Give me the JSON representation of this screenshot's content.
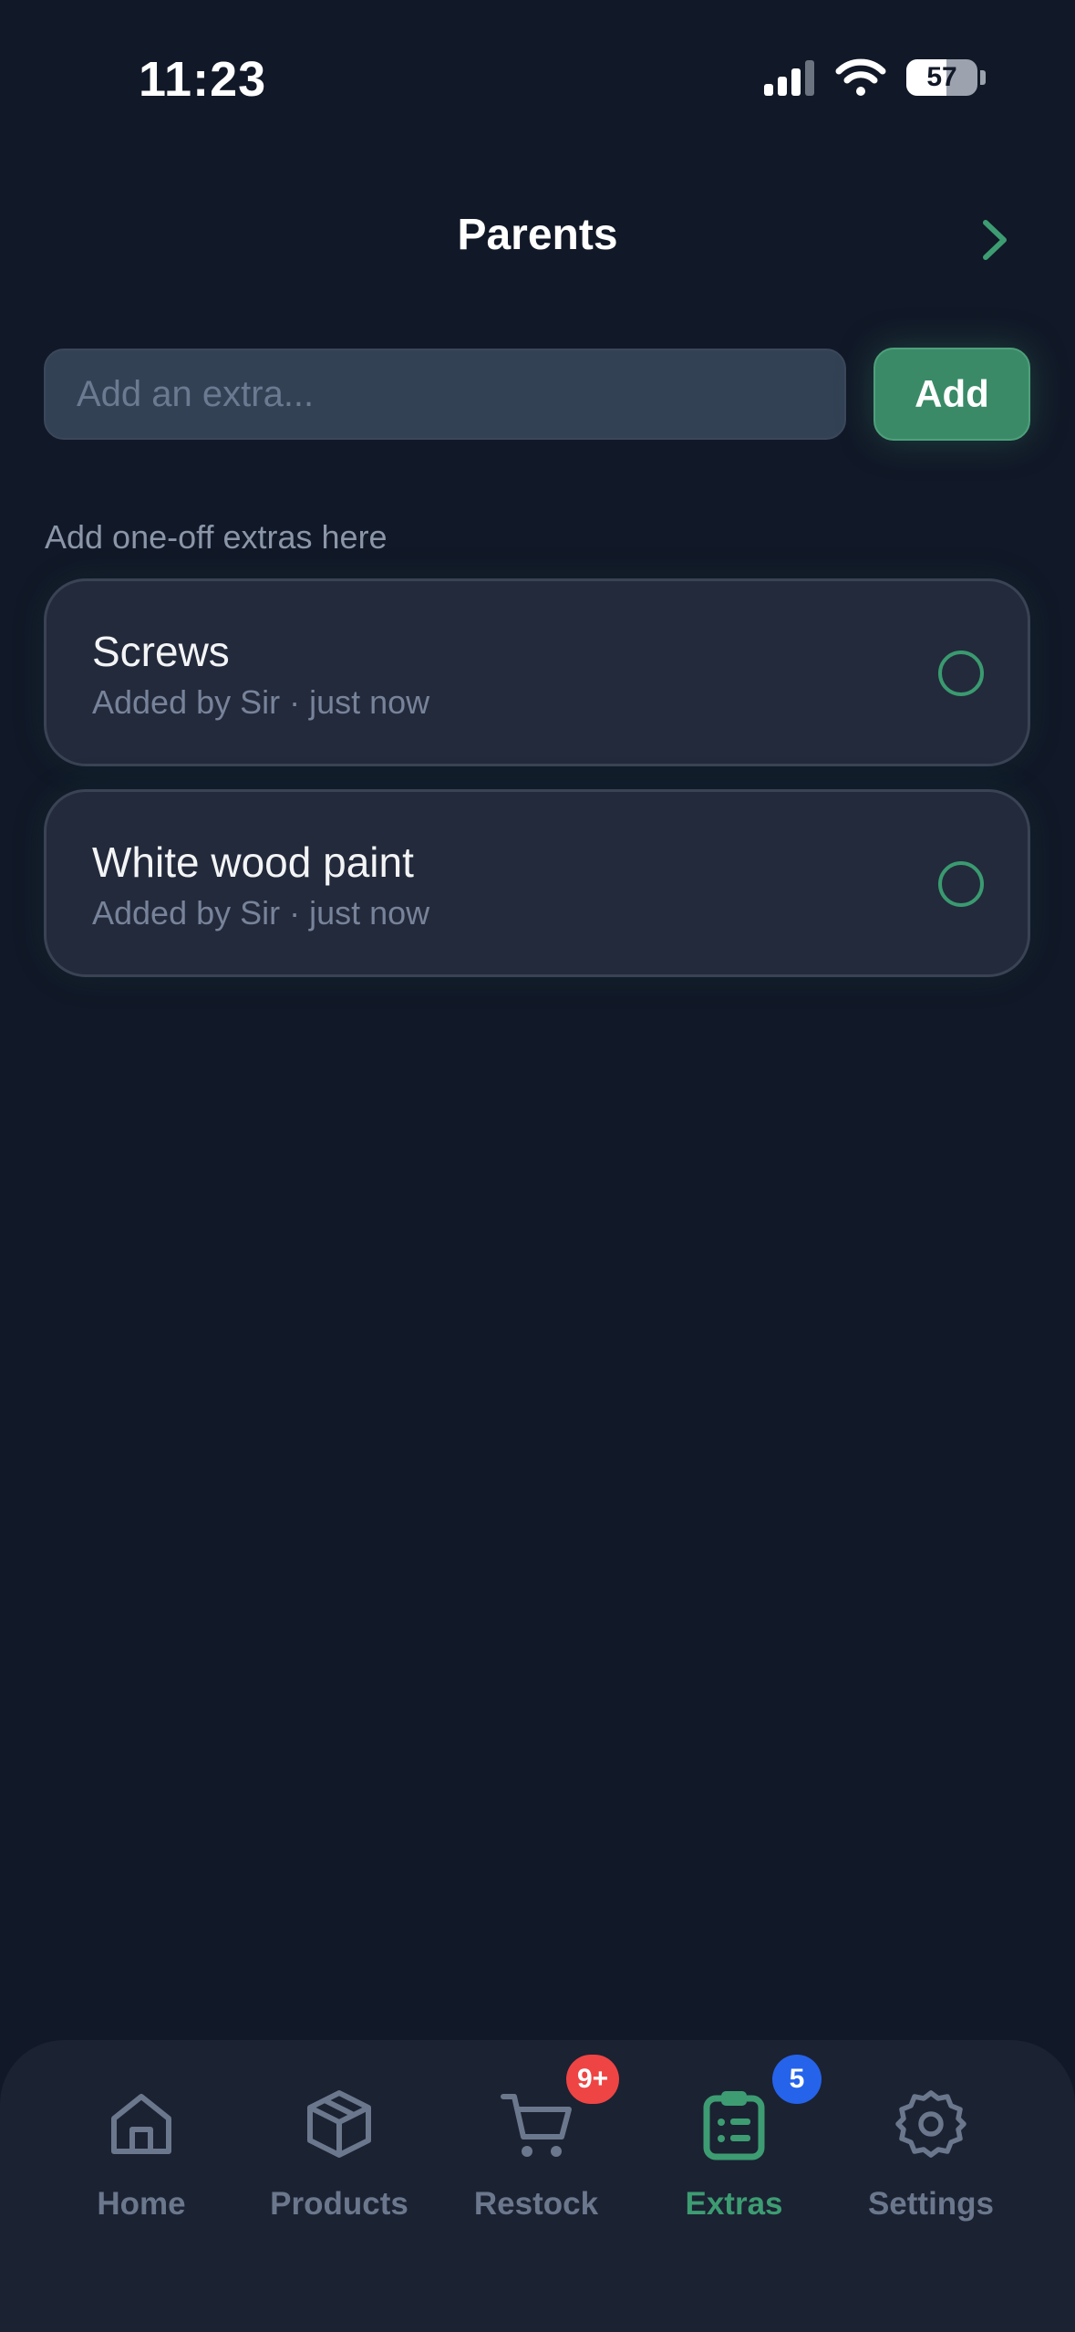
{
  "status_bar": {
    "time": "11:23",
    "battery_percent": "57",
    "battery_level": 0.57
  },
  "header": {
    "title": "Parents",
    "next_icon": "chevron-right-icon"
  },
  "add_row": {
    "placeholder": "Add an extra...",
    "value": "",
    "button_label": "Add"
  },
  "hint": "Add one-off extras here",
  "extras": [
    {
      "name": "Screws",
      "meta": "Added by Sir · just now",
      "done": false
    },
    {
      "name": "White wood paint",
      "meta": "Added by Sir · just now",
      "done": false
    }
  ],
  "tabs": [
    {
      "label": "Home",
      "icon": "home-icon",
      "active": false,
      "badge": ""
    },
    {
      "label": "Products",
      "icon": "box-icon",
      "active": false,
      "badge": ""
    },
    {
      "label": "Restock",
      "icon": "cart-icon",
      "active": false,
      "badge": "9+"
    },
    {
      "label": "Extras",
      "icon": "clipboard-list-icon",
      "active": true,
      "badge": "5"
    },
    {
      "label": "Settings",
      "icon": "gear-icon",
      "active": false,
      "badge": ""
    }
  ],
  "colors": {
    "background": "#111827",
    "accent": "#3a8a67",
    "badge_red": "#ef4444",
    "badge_blue": "#2563eb",
    "tab_inactive": "#6b778c"
  }
}
